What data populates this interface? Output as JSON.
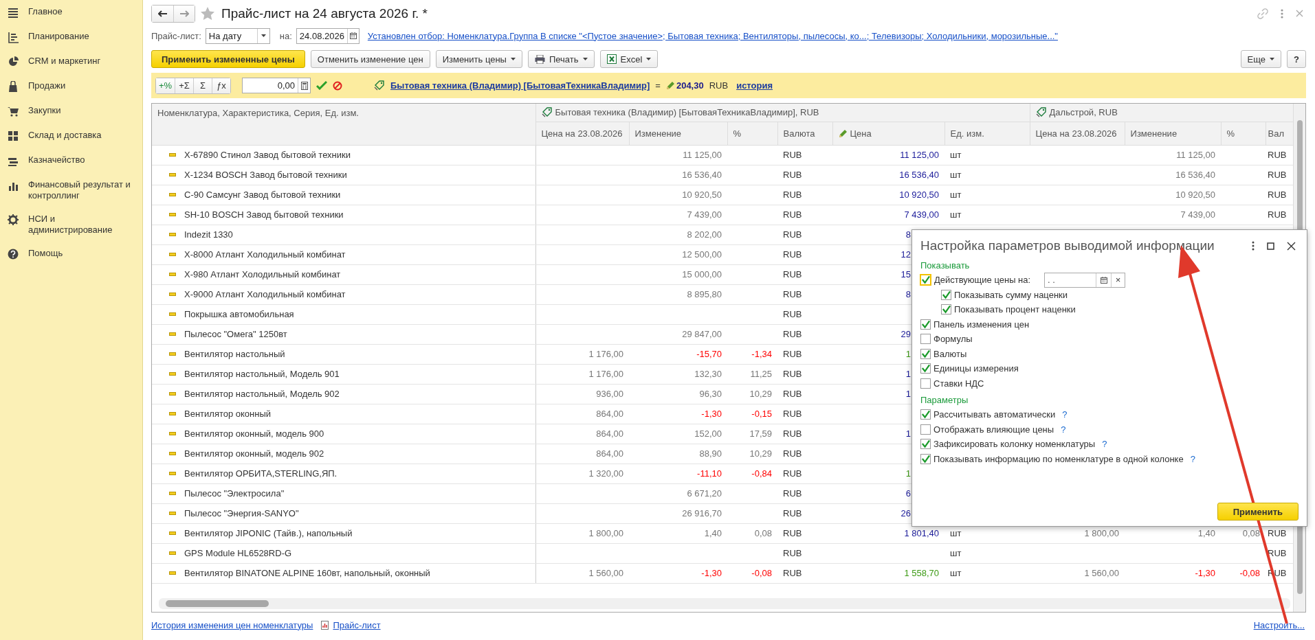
{
  "sidebar": {
    "items": [
      {
        "label": "Главное"
      },
      {
        "label": "Планирование"
      },
      {
        "label": "CRM и маркетинг"
      },
      {
        "label": "Продажи"
      },
      {
        "label": "Закупки"
      },
      {
        "label": "Склад и доставка"
      },
      {
        "label": "Казначейство"
      },
      {
        "label": "Финансовый результат и контроллинг"
      },
      {
        "label": "НСИ и администрирование"
      },
      {
        "label": "Помощь"
      }
    ]
  },
  "header": {
    "title": "Прайс-лист на 24 августа 2026 г. *"
  },
  "filter": {
    "price_list_label": "Прайс-лист:",
    "price_list_value": "На дату",
    "date_label": "на:",
    "date_value": "24.08.2026",
    "selection_link": "Установлен отбор: Номенклатура.Группа В списке \"<Пустое значение>; Бытовая техника; Вентиляторы, пылесосы, ко...; Телевизоры; Холодильники, морозильные...\""
  },
  "toolbar": {
    "buttons": [
      {
        "label": "Применить измененные цены",
        "kind": "primary"
      },
      {
        "label": "Отменить изменение цен",
        "kind": "plain"
      },
      {
        "label": "Изменить цены",
        "kind": "menu"
      },
      {
        "label": "Печать",
        "kind": "print"
      },
      {
        "label": "Excel",
        "kind": "excel"
      }
    ],
    "more_button": "Еще",
    "help_button": "?"
  },
  "price_panel": {
    "ops": [
      "+%",
      "+Σ",
      "Σ",
      "ƒx"
    ],
    "amount": "0,00",
    "price_type_link": "Бытовая техника (Владимир) [БытоваяТехникаВладимир]",
    "equals": "=",
    "price": "204,30",
    "currency": "RUB",
    "history_link": "история"
  },
  "table": {
    "name_header": "Номенклатура, Характеристика, Серия, Ед. изм.",
    "groups": [
      {
        "title": "Бытовая техника (Владимир) [БытоваяТехникаВладимир], RUB",
        "columns": [
          {
            "label": "Цена на 23.08.2026",
            "editable": false
          },
          {
            "label": "Изменение",
            "editable": false
          },
          {
            "label": "%",
            "editable": false
          },
          {
            "label": "Валюта",
            "editable": false
          },
          {
            "label": "Цена",
            "editable": true
          },
          {
            "label": "Ед. изм.",
            "editable": false
          }
        ]
      },
      {
        "title": "Дальстрой, RUB",
        "columns": [
          {
            "label": "Цена на 23.08.2026",
            "editable": false
          },
          {
            "label": "Изменение",
            "editable": false
          },
          {
            "label": "%",
            "editable": false
          },
          {
            "label": "Вал",
            "editable": false
          }
        ]
      }
    ],
    "rows": [
      {
        "kind": "full",
        "name": "X-67890 Стинол Завод бытовой техники",
        "change": "11 125,00",
        "currency": "RUB",
        "price": "11 125,00",
        "unit": "шт",
        "d_change": "11 125,00",
        "d_currency": "RUB",
        "negative": false
      },
      {
        "kind": "full",
        "name": "X-1234 BOSCH Завод бытовой техники",
        "change": "16 536,40",
        "currency": "RUB",
        "price": "16 536,40",
        "unit": "шт",
        "d_change": "16 536,40",
        "d_currency": "RUB",
        "negative": false
      },
      {
        "kind": "full",
        "name": "C-90 Самсунг Завод бытовой техники",
        "change": "10 920,50",
        "currency": "RUB",
        "price": "10 920,50",
        "unit": "шт",
        "d_change": "10 920,50",
        "d_currency": "RUB",
        "negative": false
      },
      {
        "kind": "full",
        "name": "SH-10 BOSCH Завод бытовой техники",
        "change": "7 439,00",
        "currency": "RUB",
        "price": "7 439,00",
        "unit": "шт",
        "d_change": "7 439,00",
        "d_currency": "RUB",
        "negative": false
      },
      {
        "kind": "partial",
        "name": "Indezit 1330",
        "change": "8 202,00",
        "currency": "RUB",
        "price": "8",
        "negative": false
      },
      {
        "kind": "partial",
        "name": "X-8000 Атлант Холодильный комбинат",
        "change": "12 500,00",
        "currency": "RUB",
        "price": "12",
        "negative": false
      },
      {
        "kind": "partial",
        "name": "X-980 Атлант Холодильный комбинат",
        "change": "15 000,00",
        "currency": "RUB",
        "price": "15",
        "negative": false
      },
      {
        "kind": "partial",
        "name": "X-9000 Атлант Холодильный комбинат",
        "change": "8 895,80",
        "currency": "RUB",
        "price": "8",
        "negative": false
      },
      {
        "kind": "partial",
        "name": "Покрышка автомобильная",
        "currency": "RUB"
      },
      {
        "kind": "partial",
        "name": "Пылесос \"Омега\" 1250вт",
        "change": "29 847,00",
        "currency": "RUB",
        "price": "29",
        "negative": false
      },
      {
        "kind": "partial",
        "name": "Вентилятор настольный",
        "prev": "1 176,00",
        "change": "-15,70",
        "pct": "-1,34",
        "currency": "RUB",
        "price": "1",
        "negative": true
      },
      {
        "kind": "partial",
        "name": "Вентилятор настольный, Модель 901",
        "prev": "1 176,00",
        "change": "132,30",
        "pct": "11,25",
        "currency": "RUB",
        "price": "1",
        "negative": false
      },
      {
        "kind": "partial",
        "name": "Вентилятор настольный, Модель 902",
        "prev": "936,00",
        "change": "96,30",
        "pct": "10,29",
        "currency": "RUB",
        "price": "1",
        "negative": false
      },
      {
        "kind": "partial",
        "name": "Вентилятор оконный",
        "prev": "864,00",
        "change": "-1,30",
        "pct": "-0,15",
        "currency": "RUB",
        "negative": true
      },
      {
        "kind": "partial",
        "name": "Вентилятор оконный, модель 900",
        "prev": "864,00",
        "change": "152,00",
        "pct": "17,59",
        "currency": "RUB",
        "price": "1",
        "negative": false
      },
      {
        "kind": "partial",
        "name": "Вентилятор оконный, модель 902",
        "prev": "864,00",
        "change": "88,90",
        "pct": "10,29",
        "currency": "RUB",
        "negative": false
      },
      {
        "kind": "partial",
        "name": "Вентилятор ОРБИТА,STERLING,ЯП.",
        "prev": "1 320,00",
        "change": "-11,10",
        "pct": "-0,84",
        "currency": "RUB",
        "price": "1",
        "negative": true
      },
      {
        "kind": "partial",
        "name": "Пылесос \"Электросила\"",
        "change": "6 671,20",
        "currency": "RUB",
        "price": "6",
        "negative": false
      },
      {
        "kind": "partial",
        "name": "Пылесос \"Энергия-SANYO\"",
        "change": "26 916,70",
        "currency": "RUB",
        "price": "26",
        "negative": false
      },
      {
        "kind": "full",
        "name": "Вентилятор JIPONIC (Тайв.), напольный",
        "prev": "1 800,00",
        "change": "1,40",
        "pct": "0,08",
        "currency": "RUB",
        "price": "1 801,40",
        "unit": "шт",
        "d_prev": "1 800,00",
        "d_change": "1,40",
        "d_pct": "0,08",
        "d_currency": "RUB",
        "negative": false
      },
      {
        "kind": "full",
        "name": "GPS Module HL6528RD-G",
        "currency": "RUB",
        "unit": "шт",
        "d_currency": "RUB"
      },
      {
        "kind": "full",
        "name": "Вентилятор BINATONE ALPINE 160вт, напольный, оконный",
        "prev": "1 560,00",
        "change": "-1,30",
        "pct": "-0,08",
        "currency": "RUB",
        "price": "1 558,70",
        "unit": "шт",
        "d_prev": "1 560,00",
        "d_change": "-1,30",
        "d_pct": "-0,08",
        "d_currency": "RUB",
        "negative": true
      }
    ]
  },
  "footer": {
    "links": [
      "История изменения цен номенклатуры",
      "Прайс-лист"
    ],
    "settings_link": "Настроить..."
  },
  "dialog": {
    "title": "Настройка параметров выводимой информации",
    "sections": [
      {
        "title": "Показывать",
        "items": [
          {
            "label": "Действующие цены на:",
            "checked": true,
            "focused": true,
            "date_value": ". .",
            "clear": "×",
            "children": [
              {
                "label": "Показывать сумму наценки",
                "checked": true
              },
              {
                "label": "Показывать процент наценки",
                "checked": true
              }
            ]
          },
          {
            "label": "Панель изменения цен",
            "checked": true
          },
          {
            "label": "Формулы",
            "checked": false
          },
          {
            "label": "Валюты",
            "checked": true
          },
          {
            "label": "Единицы измерения",
            "checked": true
          },
          {
            "label": "Ставки НДС",
            "checked": false
          }
        ]
      },
      {
        "title": "Параметры",
        "items": [
          {
            "label": "Рассчитывать автоматически",
            "checked": true,
            "help": "?"
          },
          {
            "label": "Отображать влияющие цены",
            "checked": false,
            "help": "?"
          },
          {
            "label": "Зафиксировать колонку номенклатуры",
            "checked": true,
            "help": "?"
          },
          {
            "label": "Показывать информацию по номенклатуре в одной колонке",
            "checked": true,
            "help": "?"
          }
        ]
      }
    ],
    "apply_button": "Применить"
  }
}
